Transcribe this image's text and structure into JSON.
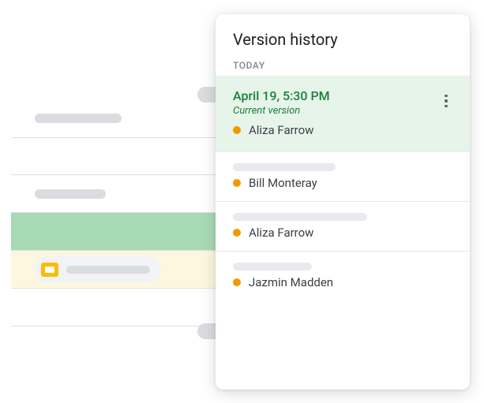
{
  "panel": {
    "title": "Version history",
    "section_label": "TODAY"
  },
  "versions": [
    {
      "timestamp": "April 19, 5:30 PM",
      "sublabel": "Current version",
      "author": "Aliza Farrow",
      "is_current": true,
      "dot_color": "#f29900"
    },
    {
      "author": "Bill Monteray",
      "dot_color": "#f29900"
    },
    {
      "author": "Aliza Farrow",
      "dot_color": "#f29900"
    },
    {
      "author": "Jazmin Madden",
      "dot_color": "#f29900"
    }
  ]
}
